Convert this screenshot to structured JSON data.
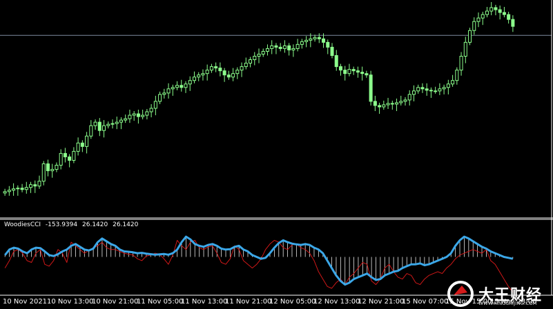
{
  "colors": {
    "background": "#000000",
    "candle": "#8CFF8C",
    "grid_line": "#7F8C9F",
    "cci_main": "#3BA7E8",
    "cci_signal": "#D01818",
    "histogram": "#E8E8E8",
    "frame": "#FFFFFF"
  },
  "indicator": {
    "name": "WoodiesCCI",
    "values": [
      "-153.9394",
      "26.1420",
      "26.1420"
    ]
  },
  "time_axis": {
    "labels": [
      "10 Nov 2021",
      "10 Nov 13:00",
      "10 Nov 21:00",
      "11 Nov 05:00",
      "11 Nov 13:00",
      "11 Nov 21:00",
      "12 Nov 05:00",
      "12 Nov 13:00",
      "12 Nov 21:00",
      "15 Nov 07:00",
      "15 Nov 15:00",
      "15 Nov 23:00"
    ]
  },
  "watermark": {
    "text": "大王财经",
    "url": "WWW.KINGCAIJING.COM"
  },
  "chart_data": [
    {
      "type": "candlestick",
      "title": "",
      "price_range": [
        0,
        300
      ],
      "horizontal_level": 255,
      "closes": [
        30,
        32,
        34,
        35,
        33,
        36,
        40,
        38,
        45,
        70,
        60,
        62,
        68,
        85,
        80,
        75,
        88,
        100,
        95,
        110,
        125,
        130,
        118,
        125,
        127,
        128,
        130,
        133,
        135,
        140,
        142,
        138,
        140,
        145,
        150,
        160,
        170,
        172,
        178,
        180,
        183,
        180,
        185,
        190,
        195,
        198,
        200,
        205,
        210,
        208,
        204,
        198,
        195,
        200,
        205,
        210,
        215,
        220,
        225,
        228,
        232,
        236,
        240,
        238,
        236,
        240,
        234,
        236,
        242,
        246,
        248,
        250,
        252,
        250,
        245,
        238,
        226,
        210,
        205,
        200,
        206,
        204,
        202,
        200,
        198,
        160,
        154,
        152,
        155,
        157,
        156,
        158,
        160,
        162,
        170,
        175,
        180,
        178,
        176,
        175,
        175,
        178,
        180,
        185,
        190,
        205,
        225,
        245,
        262,
        275,
        280,
        285,
        290,
        295,
        292,
        288,
        285,
        278,
        268
      ],
      "ohlc_note": "values read as approximate close levels in chart price units (unlabeled price axis)"
    },
    {
      "type": "line",
      "title": "WoodiesCCI",
      "y_range": [
        -200,
        200
      ],
      "series": [
        {
          "name": "WoodiesCCI",
          "values": [
            10,
            40,
            50,
            45,
            30,
            20,
            40,
            50,
            48,
            30,
            10,
            5,
            15,
            30,
            40,
            60,
            70,
            55,
            40,
            35,
            45,
            80,
            100,
            85,
            70,
            60,
            40,
            30,
            28,
            25,
            20,
            22,
            18,
            15,
            12,
            14,
            16,
            12,
            20,
            40,
            80,
            110,
            95,
            70,
            60,
            55,
            65,
            70,
            60,
            45,
            40,
            42,
            55,
            60,
            40,
            30,
            10,
            0,
            -10,
            -5,
            20,
            50,
            75,
            90,
            80,
            72,
            68,
            65,
            70,
            65,
            50,
            40,
            20,
            -20,
            -60,
            -100,
            -130,
            -150,
            -140,
            -120,
            -110,
            -100,
            -90,
            -110,
            -125,
            -120,
            -100,
            -90,
            -80,
            -75,
            -60,
            -50,
            -40,
            -40,
            -35,
            -45,
            -40,
            -30,
            -20,
            -10,
            0,
            20,
            60,
            90,
            110,
            100,
            85,
            70,
            55,
            45,
            30,
            20,
            10,
            0,
            -5,
            -10
          ]
        },
        {
          "name": "",
          "values": [
            -60,
            -20,
            30,
            40,
            20,
            -20,
            -30,
            20,
            40,
            -40,
            -50,
            -20,
            40,
            20,
            -30,
            80,
            60,
            40,
            20,
            35,
            50,
            60,
            80,
            50,
            40,
            40,
            30,
            20,
            15,
            10,
            -10,
            -20,
            5,
            10,
            20,
            15,
            -10,
            -40,
            10,
            90,
            60,
            40,
            80,
            90,
            50,
            40,
            55,
            60,
            20,
            -30,
            -40,
            -10,
            60,
            40,
            -20,
            -40,
            -60,
            -40,
            -10,
            40,
            70,
            90,
            80,
            50,
            40,
            65,
            70,
            50,
            40,
            20,
            -20,
            -80,
            -120,
            -160,
            -170,
            -140,
            -120,
            -150,
            -110,
            -90,
            -60,
            -30,
            -40,
            -130,
            -150,
            -120,
            -60,
            -40,
            -80,
            -110,
            -120,
            -90,
            -100,
            -140,
            -150,
            -120,
            -100,
            -90,
            -80,
            -90,
            -60,
            -40,
            -10,
            10,
            20,
            30,
            40,
            30,
            20,
            40,
            -20,
            -40,
            -80,
            -120,
            -160,
            -190
          ]
        }
      ]
    }
  ]
}
